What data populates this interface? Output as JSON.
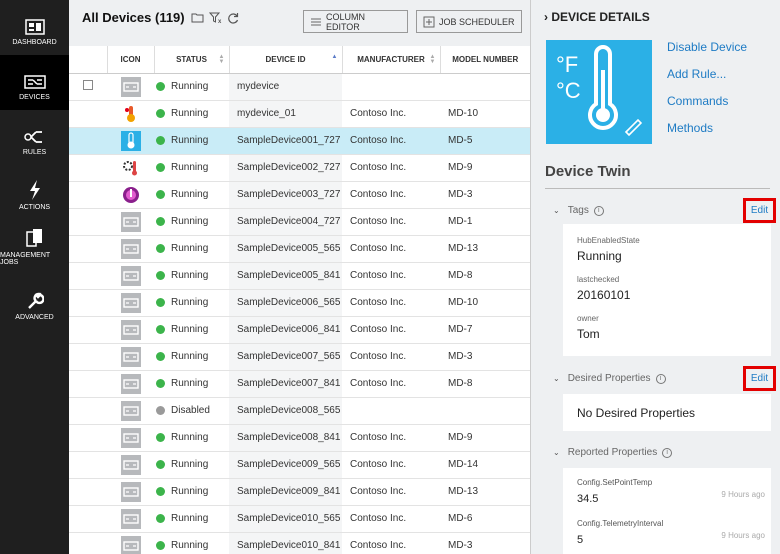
{
  "nav": {
    "items": [
      {
        "label": "DASHBOARD",
        "icon": "dashboard-icon",
        "active": false
      },
      {
        "label": "DEVICES",
        "icon": "devices-icon",
        "active": true
      },
      {
        "label": "RULES",
        "icon": "rules-icon",
        "active": false
      },
      {
        "label": "ACTIONS",
        "icon": "actions-icon",
        "active": false
      },
      {
        "label": "MANAGEMENT JOBS",
        "icon": "management-jobs-icon",
        "active": false
      },
      {
        "label": "ADVANCED",
        "icon": "wrench-icon",
        "active": false
      }
    ]
  },
  "list": {
    "title": "All Devices (119)",
    "column_editor_label": "COLUMN EDITOR",
    "job_scheduler_label": "JOB SCHEDULER",
    "columns": [
      "ICON",
      "STATUS",
      "DEVICE ID",
      "MANUFACTURER",
      "MODEL NUMBER"
    ],
    "rows": [
      {
        "icon": "generic",
        "status": "Running",
        "device_id": "mydevice",
        "manufacturer": "",
        "model": "",
        "checkbox": true
      },
      {
        "icon": "thermo-red",
        "status": "Running",
        "device_id": "mydevice_01",
        "manufacturer": "Contoso Inc.",
        "model": "MD-10"
      },
      {
        "icon": "thermo-blue",
        "status": "Running",
        "device_id": "SampleDevice001_727",
        "manufacturer": "Contoso Inc.",
        "model": "MD-5",
        "selected": true
      },
      {
        "icon": "thermo-gear",
        "status": "Running",
        "device_id": "SampleDevice002_727",
        "manufacturer": "Contoso Inc.",
        "model": "MD-9"
      },
      {
        "icon": "thermo-purple",
        "status": "Running",
        "device_id": "SampleDevice003_727",
        "manufacturer": "Contoso Inc.",
        "model": "MD-3"
      },
      {
        "icon": "generic",
        "status": "Running",
        "device_id": "SampleDevice004_727",
        "manufacturer": "Contoso Inc.",
        "model": "MD-1"
      },
      {
        "icon": "generic",
        "status": "Running",
        "device_id": "SampleDevice005_565",
        "manufacturer": "Contoso Inc.",
        "model": "MD-13"
      },
      {
        "icon": "generic",
        "status": "Running",
        "device_id": "SampleDevice005_841",
        "manufacturer": "Contoso Inc.",
        "model": "MD-8"
      },
      {
        "icon": "generic",
        "status": "Running",
        "device_id": "SampleDevice006_565",
        "manufacturer": "Contoso Inc.",
        "model": "MD-10"
      },
      {
        "icon": "generic",
        "status": "Running",
        "device_id": "SampleDevice006_841",
        "manufacturer": "Contoso Inc.",
        "model": "MD-7"
      },
      {
        "icon": "generic",
        "status": "Running",
        "device_id": "SampleDevice007_565",
        "manufacturer": "Contoso Inc.",
        "model": "MD-3"
      },
      {
        "icon": "generic",
        "status": "Running",
        "device_id": "SampleDevice007_841",
        "manufacturer": "Contoso Inc.",
        "model": "MD-8"
      },
      {
        "icon": "generic",
        "status": "Disabled",
        "device_id": "SampleDevice008_565",
        "manufacturer": "",
        "model": ""
      },
      {
        "icon": "generic",
        "status": "Running",
        "device_id": "SampleDevice008_841",
        "manufacturer": "Contoso Inc.",
        "model": "MD-9"
      },
      {
        "icon": "generic",
        "status": "Running",
        "device_id": "SampleDevice009_565",
        "manufacturer": "Contoso Inc.",
        "model": "MD-14"
      },
      {
        "icon": "generic",
        "status": "Running",
        "device_id": "SampleDevice009_841",
        "manufacturer": "Contoso Inc.",
        "model": "MD-13"
      },
      {
        "icon": "generic",
        "status": "Running",
        "device_id": "SampleDevice010_565",
        "manufacturer": "Contoso Inc.",
        "model": "MD-6"
      },
      {
        "icon": "generic",
        "status": "Running",
        "device_id": "SampleDevice010_841",
        "manufacturer": "Contoso Inc.",
        "model": "MD-3"
      }
    ]
  },
  "details": {
    "title": "DEVICE DETAILS",
    "links": [
      "Disable Device",
      "Add Rule...",
      "Commands",
      "Methods"
    ],
    "twin_title": "Device Twin",
    "tags": {
      "label": "Tags",
      "edit_label": "Edit",
      "items": [
        {
          "key": "HubEnabledState",
          "value": "Running"
        },
        {
          "key": "lastchecked",
          "value": "20160101"
        },
        {
          "key": "owner",
          "value": "Tom"
        }
      ]
    },
    "desired": {
      "label": "Desired Properties",
      "edit_label": "Edit",
      "empty_text": "No Desired Properties"
    },
    "reported": {
      "label": "Reported Properties",
      "items": [
        {
          "key": "Config.SetPointTemp",
          "value": "34.5",
          "time": "9 Hours ago"
        },
        {
          "key": "Config.TelemetryInterval",
          "value": "5",
          "time": "9 Hours ago"
        }
      ]
    }
  },
  "colors": {
    "running": "#3cb44b",
    "disabled": "#9a9a9a",
    "selected_row": "#c9ecf7",
    "link": "#1e7bc4",
    "highlight_box": "#e30000"
  }
}
